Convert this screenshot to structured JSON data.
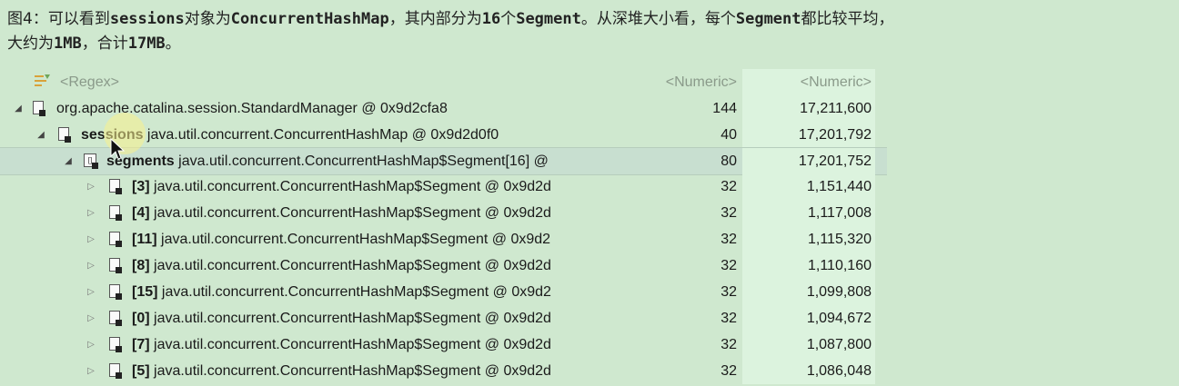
{
  "caption": {
    "line1_a": "图4：可以看到",
    "line1_b": "sessions",
    "line1_c": "对象为",
    "line1_d": "ConcurrentHashMap",
    "line1_e": "，其内部分为",
    "line1_f": "16",
    "line1_g": "个",
    "line1_h": "Segment",
    "line1_i": "。从深堆大小看，每个",
    "line1_j": "Segment",
    "line1_k": "都比较平均，",
    "line2_a": "大约为",
    "line2_b": "1MB",
    "line2_c": "，合计",
    "line2_d": "17MB",
    "line2_e": "。"
  },
  "header": {
    "filter": "<Regex>",
    "col_shallow": "<Numeric>",
    "col_retained": "<Numeric>"
  },
  "rows": [
    {
      "bold": "",
      "text": "org.apache.catalina.session.StandardManager @ 0x9d2cfa8",
      "shallow": "144",
      "retained": "17,211,600"
    },
    {
      "bold": "sessions",
      "text": " java.util.concurrent.ConcurrentHashMap @ 0x9d2d0f0",
      "shallow": "40",
      "retained": "17,201,792"
    },
    {
      "bold": "segments",
      "text": " java.util.concurrent.ConcurrentHashMap$Segment[16] @",
      "shallow": "80",
      "retained": "17,201,752",
      "array_icon": "[]"
    },
    {
      "bold": "[3]",
      "text": " java.util.concurrent.ConcurrentHashMap$Segment @ 0x9d2d",
      "shallow": "32",
      "retained": "1,151,440"
    },
    {
      "bold": "[4]",
      "text": " java.util.concurrent.ConcurrentHashMap$Segment @ 0x9d2d",
      "shallow": "32",
      "retained": "1,117,008"
    },
    {
      "bold": "[11]",
      "text": " java.util.concurrent.ConcurrentHashMap$Segment @ 0x9d2",
      "shallow": "32",
      "retained": "1,115,320"
    },
    {
      "bold": "[8]",
      "text": " java.util.concurrent.ConcurrentHashMap$Segment @ 0x9d2d",
      "shallow": "32",
      "retained": "1,110,160"
    },
    {
      "bold": "[15]",
      "text": " java.util.concurrent.ConcurrentHashMap$Segment @ 0x9d2",
      "shallow": "32",
      "retained": "1,099,808"
    },
    {
      "bold": "[0]",
      "text": " java.util.concurrent.ConcurrentHashMap$Segment @ 0x9d2d",
      "shallow": "32",
      "retained": "1,094,672"
    },
    {
      "bold": "[7]",
      "text": " java.util.concurrent.ConcurrentHashMap$Segment @ 0x9d2d",
      "shallow": "32",
      "retained": "1,087,800"
    },
    {
      "bold": "[5]",
      "text": " java.util.concurrent.ConcurrentHashMap$Segment @ 0x9d2d",
      "shallow": "32",
      "retained": "1,086,048"
    }
  ],
  "icons": {
    "expanded": "◢",
    "collapsed": "▷",
    "filter": "filter-icon",
    "object": "object-icon",
    "array": "array-icon"
  },
  "colors": {
    "background": "#cfe8cf",
    "retained_column": "#dcf3de",
    "selected_row": "#c8dfd0"
  }
}
